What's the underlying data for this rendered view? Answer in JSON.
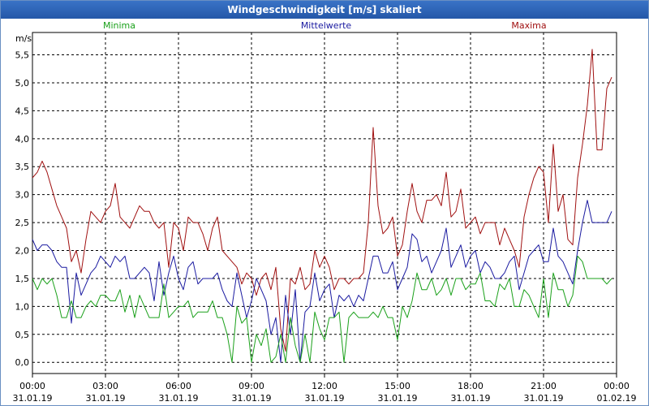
{
  "window": {
    "title": "Windgeschwindigkeit [m/s] skaliert"
  },
  "chart_data": {
    "type": "line",
    "title": "Windgeschwindigkeit [m/s] skaliert",
    "ylabel": "m/s",
    "ylim": [
      -0.2,
      5.9
    ],
    "yticks": [
      0.0,
      0.5,
      1.0,
      1.5,
      2.0,
      2.5,
      3.0,
      3.5,
      4.0,
      4.5,
      5.0,
      5.5
    ],
    "ytick_labels": [
      "0,0",
      "0,5",
      "1,0",
      "1,5",
      "2,0",
      "2,5",
      "3,0",
      "3,5",
      "4,0",
      "4,5",
      "5,0",
      "5,5"
    ],
    "xlim_hours": [
      0,
      24
    ],
    "xticks": [
      {
        "h": 0,
        "time": "00:00",
        "date": "31.01.19"
      },
      {
        "h": 3,
        "time": "03:00",
        "date": "31.01.19"
      },
      {
        "h": 6,
        "time": "06:00",
        "date": "31.01.19"
      },
      {
        "h": 9,
        "time": "09:00",
        "date": "31.01.19"
      },
      {
        "h": 12,
        "time": "12:00",
        "date": "31.01.19"
      },
      {
        "h": 15,
        "time": "15:00",
        "date": "31.01.19"
      },
      {
        "h": 18,
        "time": "18:00",
        "date": "31.01.19"
      },
      {
        "h": 21,
        "time": "21:00",
        "date": "31.01.19"
      },
      {
        "h": 24,
        "time": "00:00",
        "date": "01.02.19"
      }
    ],
    "grid": true,
    "series": [
      {
        "name": "Maxima",
        "color": "#a01010",
        "x_hours": [
          0.0,
          0.2,
          0.4,
          0.6,
          0.8,
          1.0,
          1.2,
          1.4,
          1.6,
          1.8,
          2.0,
          2.2,
          2.4,
          2.6,
          2.8,
          3.0,
          3.2,
          3.4,
          3.6,
          3.8,
          4.0,
          4.2,
          4.4,
          4.6,
          4.8,
          5.0,
          5.2,
          5.4,
          5.6,
          5.8,
          6.0,
          6.2,
          6.4,
          6.6,
          6.8,
          7.0,
          7.2,
          7.4,
          7.6,
          7.8,
          8.0,
          8.2,
          8.4,
          8.6,
          8.8,
          9.0,
          9.2,
          9.4,
          9.6,
          9.8,
          10.0,
          10.2,
          10.4,
          10.6,
          10.8,
          11.0,
          11.2,
          11.4,
          11.6,
          11.8,
          12.0,
          12.2,
          12.4,
          12.6,
          12.8,
          13.0,
          13.2,
          13.4,
          13.6,
          13.8,
          14.0,
          14.2,
          14.4,
          14.6,
          14.8,
          15.0,
          15.2,
          15.4,
          15.6,
          15.8,
          16.0,
          16.2,
          16.4,
          16.6,
          16.8,
          17.0,
          17.2,
          17.4,
          17.6,
          17.8,
          18.0,
          18.2,
          18.4,
          18.6,
          18.8,
          19.0,
          19.2,
          19.4,
          19.6,
          19.8,
          20.0,
          20.2,
          20.4,
          20.6,
          20.8,
          21.0,
          21.2,
          21.4,
          21.6,
          21.8,
          22.0,
          22.2,
          22.4,
          22.6,
          22.8,
          23.0,
          23.2,
          23.4,
          23.6,
          23.8
        ],
        "values": [
          3.3,
          3.4,
          3.6,
          3.4,
          3.1,
          2.8,
          2.6,
          2.4,
          1.8,
          2.0,
          1.6,
          2.2,
          2.7,
          2.6,
          2.5,
          2.7,
          2.8,
          3.2,
          2.6,
          2.5,
          2.4,
          2.6,
          2.8,
          2.7,
          2.7,
          2.5,
          2.4,
          2.5,
          1.7,
          2.5,
          2.4,
          2.0,
          2.6,
          2.5,
          2.5,
          2.3,
          2.0,
          2.4,
          2.6,
          2.0,
          1.9,
          1.8,
          1.7,
          1.4,
          1.6,
          1.5,
          1.2,
          1.5,
          1.6,
          1.3,
          1.7,
          0.6,
          0.2,
          1.5,
          1.4,
          1.7,
          1.3,
          1.4,
          2.0,
          1.7,
          1.9,
          1.7,
          1.3,
          1.5,
          1.5,
          1.4,
          1.5,
          1.5,
          1.6,
          2.5,
          4.2,
          2.8,
          2.3,
          2.4,
          2.6,
          1.9,
          2.1,
          2.7,
          3.2,
          2.7,
          2.5,
          2.9,
          2.9,
          3.0,
          2.8,
          3.4,
          2.6,
          2.7,
          3.1,
          2.4,
          2.5,
          2.6,
          2.3,
          2.5,
          2.5,
          2.5,
          2.1,
          2.4,
          2.2,
          2.0,
          1.7,
          2.6,
          3.0,
          3.3,
          3.5,
          3.4,
          2.5,
          3.9,
          2.7,
          3.0,
          2.2,
          2.1,
          3.3,
          3.9,
          4.6,
          5.6,
          3.8,
          3.8,
          4.9,
          5.1,
          5.2,
          5.4
        ]
      },
      {
        "name": "Mittelwerte",
        "color": "#1a1aa0",
        "x_hours": [
          0.0,
          0.2,
          0.4,
          0.6,
          0.8,
          1.0,
          1.2,
          1.4,
          1.6,
          1.8,
          2.0,
          2.2,
          2.4,
          2.6,
          2.8,
          3.0,
          3.2,
          3.4,
          3.6,
          3.8,
          4.0,
          4.2,
          4.4,
          4.6,
          4.8,
          5.0,
          5.2,
          5.4,
          5.6,
          5.8,
          6.0,
          6.2,
          6.4,
          6.6,
          6.8,
          7.0,
          7.2,
          7.4,
          7.6,
          7.8,
          8.0,
          8.2,
          8.4,
          8.6,
          8.8,
          9.0,
          9.2,
          9.4,
          9.6,
          9.8,
          10.0,
          10.2,
          10.4,
          10.6,
          10.8,
          11.0,
          11.2,
          11.4,
          11.6,
          11.8,
          12.0,
          12.2,
          12.4,
          12.6,
          12.8,
          13.0,
          13.2,
          13.4,
          13.6,
          13.8,
          14.0,
          14.2,
          14.4,
          14.6,
          14.8,
          15.0,
          15.2,
          15.4,
          15.6,
          15.8,
          16.0,
          16.2,
          16.4,
          16.6,
          16.8,
          17.0,
          17.2,
          17.4,
          17.6,
          17.8,
          18.0,
          18.2,
          18.4,
          18.6,
          18.8,
          19.0,
          19.2,
          19.4,
          19.6,
          19.8,
          20.0,
          20.2,
          20.4,
          20.6,
          20.8,
          21.0,
          21.2,
          21.4,
          21.6,
          21.8,
          22.0,
          22.2,
          22.4,
          22.6,
          22.8,
          23.0,
          23.2,
          23.4,
          23.6,
          23.8
        ],
        "values": [
          2.2,
          2.0,
          2.1,
          2.1,
          2.0,
          1.8,
          1.7,
          1.7,
          0.7,
          1.6,
          1.2,
          1.4,
          1.6,
          1.7,
          1.9,
          1.8,
          1.7,
          1.9,
          1.8,
          1.9,
          1.5,
          1.5,
          1.6,
          1.7,
          1.6,
          1.1,
          1.8,
          1.2,
          1.6,
          1.9,
          1.5,
          1.3,
          1.7,
          1.8,
          1.4,
          1.5,
          1.5,
          1.5,
          1.6,
          1.3,
          1.1,
          1.0,
          1.6,
          1.2,
          0.8,
          1.1,
          1.5,
          1.3,
          1.1,
          0.5,
          0.8,
          0.0,
          1.2,
          0.5,
          1.3,
          0.0,
          0.9,
          1.0,
          1.6,
          1.1,
          1.3,
          1.4,
          0.8,
          1.2,
          1.1,
          1.2,
          1.0,
          1.2,
          1.1,
          1.5,
          1.9,
          1.9,
          1.6,
          1.6,
          1.8,
          1.3,
          1.5,
          1.7,
          2.3,
          2.2,
          1.8,
          1.9,
          1.6,
          1.8,
          2.0,
          2.4,
          1.7,
          1.9,
          2.1,
          1.7,
          1.9,
          2.0,
          1.6,
          1.8,
          1.7,
          1.5,
          1.5,
          1.6,
          1.8,
          1.9,
          1.3,
          1.6,
          1.9,
          2.0,
          2.1,
          1.8,
          1.8,
          2.4,
          1.9,
          1.8,
          1.6,
          1.4,
          2.0,
          2.5,
          2.9,
          2.5,
          2.5,
          2.5,
          2.5,
          2.7,
          2.5,
          2.9
        ]
      },
      {
        "name": "Minima",
        "color": "#1aa01a",
        "x_hours": [
          0.0,
          0.2,
          0.4,
          0.6,
          0.8,
          1.0,
          1.2,
          1.4,
          1.6,
          1.8,
          2.0,
          2.2,
          2.4,
          2.6,
          2.8,
          3.0,
          3.2,
          3.4,
          3.6,
          3.8,
          4.0,
          4.2,
          4.4,
          4.6,
          4.8,
          5.0,
          5.2,
          5.4,
          5.6,
          5.8,
          6.0,
          6.2,
          6.4,
          6.6,
          6.8,
          7.0,
          7.2,
          7.4,
          7.6,
          7.8,
          8.0,
          8.2,
          8.4,
          8.6,
          8.8,
          9.0,
          9.2,
          9.4,
          9.6,
          9.8,
          10.0,
          10.2,
          10.4,
          10.6,
          10.8,
          11.0,
          11.2,
          11.4,
          11.6,
          11.8,
          12.0,
          12.2,
          12.4,
          12.6,
          12.8,
          13.0,
          13.2,
          13.4,
          13.6,
          13.8,
          14.0,
          14.2,
          14.4,
          14.6,
          14.8,
          15.0,
          15.2,
          15.4,
          15.6,
          15.8,
          16.0,
          16.2,
          16.4,
          16.6,
          16.8,
          17.0,
          17.2,
          17.4,
          17.6,
          17.8,
          18.0,
          18.2,
          18.4,
          18.6,
          18.8,
          19.0,
          19.2,
          19.4,
          19.6,
          19.8,
          20.0,
          20.2,
          20.4,
          20.6,
          20.8,
          21.0,
          21.2,
          21.4,
          21.6,
          21.8,
          22.0,
          22.2,
          22.4,
          22.6,
          22.8,
          23.0,
          23.2,
          23.4,
          23.6,
          23.8
        ],
        "values": [
          1.5,
          1.3,
          1.5,
          1.4,
          1.5,
          1.2,
          0.8,
          0.8,
          1.1,
          0.8,
          0.8,
          1.0,
          1.1,
          1.0,
          1.2,
          1.2,
          1.1,
          1.1,
          1.3,
          0.9,
          1.2,
          0.8,
          1.2,
          1.0,
          0.8,
          0.8,
          0.8,
          1.4,
          0.8,
          0.9,
          1.0,
          1.0,
          1.1,
          0.8,
          0.9,
          0.9,
          0.9,
          1.1,
          0.8,
          0.8,
          0.5,
          0.0,
          1.0,
          0.7,
          0.8,
          0.0,
          0.5,
          0.3,
          0.6,
          0.0,
          0.1,
          0.5,
          0.0,
          0.8,
          0.3,
          0.0,
          0.5,
          0.0,
          0.9,
          0.6,
          0.4,
          0.8,
          0.8,
          0.9,
          0.0,
          0.8,
          0.9,
          0.8,
          0.8,
          0.8,
          0.9,
          0.8,
          1.0,
          0.8,
          0.8,
          0.4,
          1.0,
          0.8,
          1.1,
          1.6,
          1.3,
          1.3,
          1.5,
          1.2,
          1.3,
          1.5,
          1.2,
          1.5,
          1.5,
          1.3,
          1.4,
          1.4,
          1.6,
          1.1,
          1.1,
          1.0,
          1.4,
          1.3,
          1.5,
          1.0,
          1.0,
          1.3,
          1.2,
          1.0,
          0.8,
          1.5,
          0.8,
          1.6,
          1.3,
          1.3,
          1.0,
          1.2,
          1.9,
          1.8,
          1.5,
          1.5,
          1.5,
          1.5,
          1.4,
          1.5,
          1.6,
          1.8
        ]
      }
    ]
  }
}
